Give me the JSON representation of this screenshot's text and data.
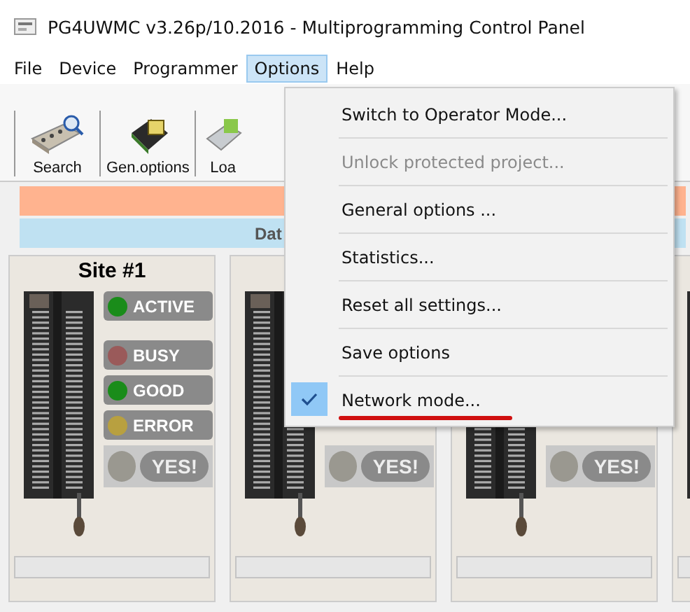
{
  "window": {
    "title": "PG4UWMC v3.26p/10.2016 - Multiprogramming Control Panel"
  },
  "menubar": [
    {
      "label": "File",
      "selected": false
    },
    {
      "label": "Device",
      "selected": false
    },
    {
      "label": "Programmer",
      "selected": false
    },
    {
      "label": "Options",
      "selected": true
    },
    {
      "label": "Help",
      "selected": false
    }
  ],
  "toolbar": [
    {
      "label": "Search",
      "kind": "search"
    },
    {
      "label": "Gen.options",
      "kind": "chip"
    },
    {
      "label": "Loa",
      "kind": "load"
    }
  ],
  "data_bar": {
    "text": "Dat"
  },
  "sites": [
    {
      "title": "Site #1",
      "leds": [
        {
          "label": "ACTIVE",
          "color": "#1a8c1a"
        },
        {
          "label": "BUSY",
          "color": "#9a5a5a"
        },
        {
          "label": "GOOD",
          "color": "#1a8c1a"
        },
        {
          "label": "ERROR",
          "color": "#b8a040"
        }
      ],
      "yes": "YES!",
      "level": 0
    },
    {
      "yes": "YES!",
      "level": 0
    },
    {
      "yes": "YES!",
      "level": 0
    },
    {
      "level": 0
    }
  ],
  "menu": {
    "items": [
      {
        "label": "Switch to Operator Mode...",
        "disabled": false,
        "checked": false
      },
      {
        "label": "Unlock protected project...",
        "disabled": true,
        "checked": false
      },
      {
        "label": "General options ...",
        "disabled": false,
        "checked": false
      },
      {
        "label": "Statistics...",
        "disabled": false,
        "checked": false
      },
      {
        "label": "Reset all settings...",
        "disabled": false,
        "checked": false
      },
      {
        "label": "Save options",
        "disabled": false,
        "checked": false
      },
      {
        "label": "Network mode...",
        "disabled": false,
        "checked": true
      }
    ]
  }
}
